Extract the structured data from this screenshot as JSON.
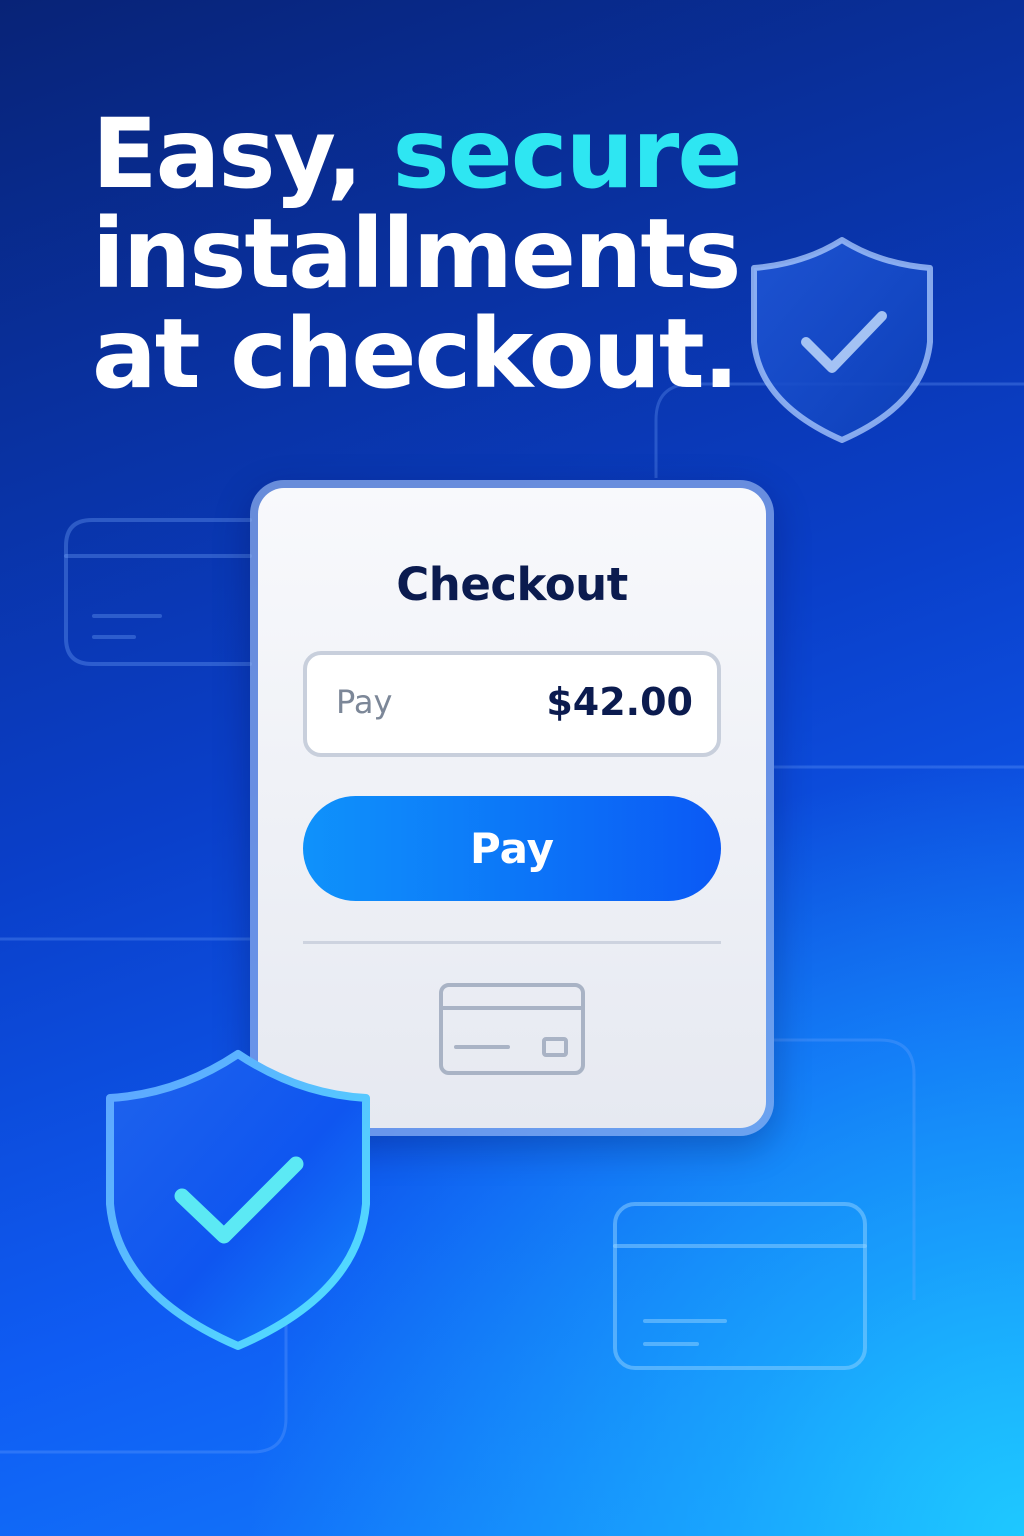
{
  "headline": {
    "line1_part1": "Easy,",
    "line1_accent": "secure",
    "line2": "installments",
    "line3": "at checkout."
  },
  "checkout_card": {
    "title": "Checkout",
    "amount_label": "Pay",
    "amount_value": "$42.00",
    "pay_button_label": "Pay",
    "payment_icon": "credit-card-icon"
  },
  "decorations": {
    "shields": [
      "shield-check-icon",
      "shield-check-icon"
    ],
    "background_cards": [
      "credit-card-outline",
      "credit-card-outline"
    ]
  },
  "colors": {
    "accent": "#2ee6f2",
    "button": "#0c76f8",
    "title_text": "#0b1b4f"
  }
}
